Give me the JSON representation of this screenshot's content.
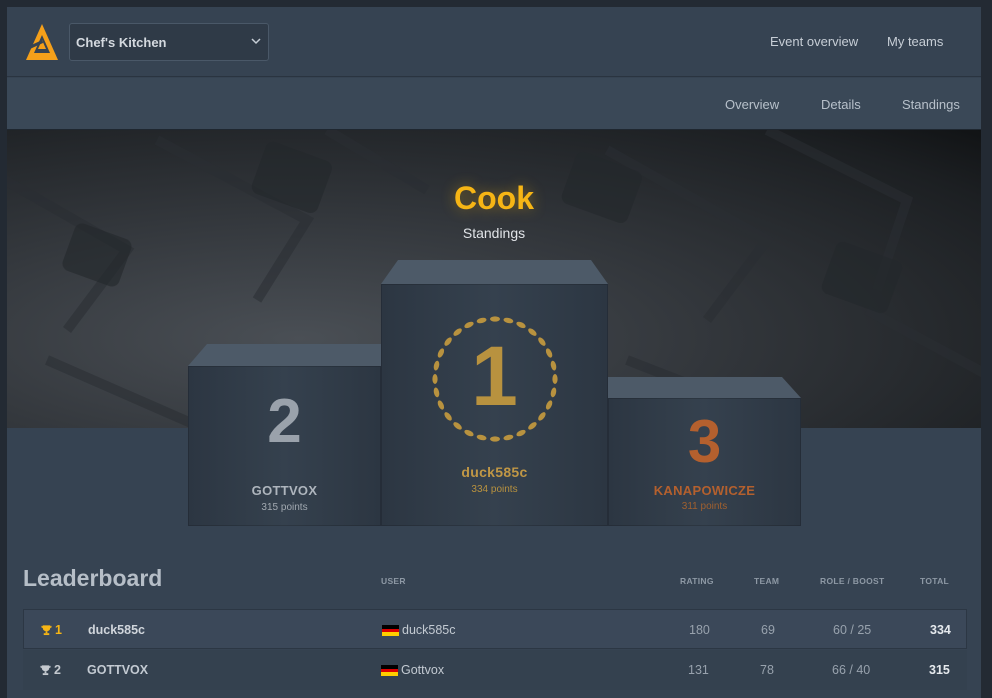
{
  "header": {
    "team_select": "Chef's Kitchen",
    "nav": [
      "Event overview",
      "My teams"
    ]
  },
  "subnav": [
    "Overview",
    "Details",
    "Standings"
  ],
  "hero": {
    "title": "Cook",
    "subtitle": "Standings"
  },
  "podium": {
    "first": {
      "rank": "1",
      "name": "duck585c",
      "points": "334 points"
    },
    "second": {
      "rank": "2",
      "name": "GOTTVOX",
      "points": "315 points"
    },
    "third": {
      "rank": "3",
      "name": "KANAPOWICZE",
      "points": "311 points"
    }
  },
  "leaderboard": {
    "title": "Leaderboard",
    "columns": {
      "user": "USER",
      "rating": "RATING",
      "team": "TEAM",
      "role_boost": "ROLE / BOOST",
      "total": "TOTAL"
    },
    "rows": [
      {
        "rank": "1",
        "team_name": "duck585c",
        "user": "duck585c",
        "rating": "180",
        "team": "69",
        "role_boost": "60 / 25",
        "total": "334"
      },
      {
        "rank": "2",
        "team_name": "GOTTVOX",
        "user": "Gottvox",
        "rating": "131",
        "team": "78",
        "role_boost": "66 / 40",
        "total": "315"
      }
    ]
  },
  "colors": {
    "gold": "#f6b515",
    "first_place": "#b8923f",
    "second_place": "#9aa2ab",
    "third_place": "#b4602e",
    "brand_orange": "#f5a01a"
  }
}
